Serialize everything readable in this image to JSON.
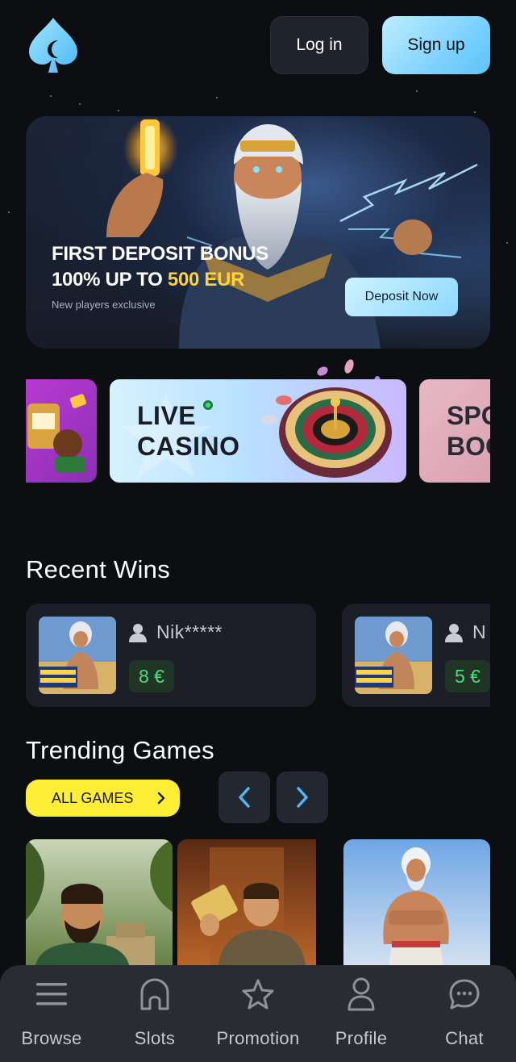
{
  "header": {
    "logo_icon": "spade-moon-logo",
    "login_label": "Log in",
    "signup_label": "Sign up"
  },
  "hero": {
    "title_line1": "FIRST DEPOSIT BONUS",
    "title_line2_prefix": "100% UP TO ",
    "title_line2_highlight": "500 EUR",
    "subtitle": "New players exclusive",
    "cta_label": "Deposit Now"
  },
  "categories": {
    "live_casino_line1": "LIVE",
    "live_casino_line2": "CASINO",
    "sports_line1": "SPO",
    "sports_line2": "BOO"
  },
  "recent_wins": {
    "title": "Recent Wins",
    "items": [
      {
        "user": "Nik*****",
        "amount": "8 €"
      },
      {
        "user": "N",
        "amount": "5 €"
      }
    ]
  },
  "trending": {
    "title": "Trending Games",
    "all_games_label": "ALL GAMES"
  },
  "nav": {
    "items": [
      {
        "label": "Browse",
        "icon": "menu-icon"
      },
      {
        "label": "Slots",
        "icon": "slots-icon"
      },
      {
        "label": "Promotion",
        "icon": "star-icon"
      },
      {
        "label": "Profile",
        "icon": "person-icon"
      },
      {
        "label": "Chat",
        "icon": "chat-icon"
      }
    ]
  },
  "colors": {
    "background": "#0d0e12",
    "accent_blue": "#7fd2ff",
    "accent_yellow": "#ffee36",
    "win_green": "#4cde7a"
  }
}
